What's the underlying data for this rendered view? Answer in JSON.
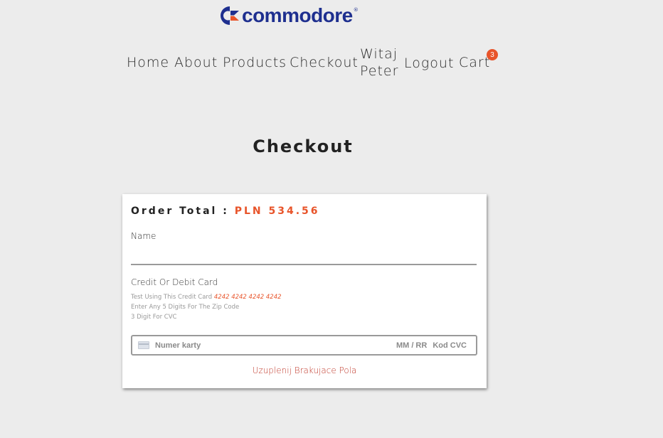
{
  "brand": {
    "logo_text": "commodore",
    "registered": "®",
    "logo_color": "#1e2f8f",
    "accent_color": "#e8542a"
  },
  "nav": {
    "home": "Home",
    "about": "About",
    "products": "Products",
    "checkout": "Checkout",
    "greeting_line1": "Witaj",
    "greeting_line2": "Peter",
    "logout": "Logout",
    "cart": "Cart",
    "cart_count": "3"
  },
  "page": {
    "title": "Checkout"
  },
  "form": {
    "order_total_label": "Order Total :",
    "order_total_value": "PLN 534.56",
    "name_label": "Name",
    "name_value": "",
    "card_label": "Credit Or Debit Card",
    "hint_card_prefix": "Test Using This Credit Card",
    "hint_card_number": "4242 4242 4242 4242",
    "hint_zip": "Enter Any 5 Digits For The Zip Code",
    "hint_cvc": "3 Digit For CVC",
    "card_number_placeholder": "Numer karty",
    "expiry_placeholder": "MM / RR",
    "cvc_placeholder": "Kod CVC",
    "error_message": "Uzuplenij Brakujace Pola"
  }
}
